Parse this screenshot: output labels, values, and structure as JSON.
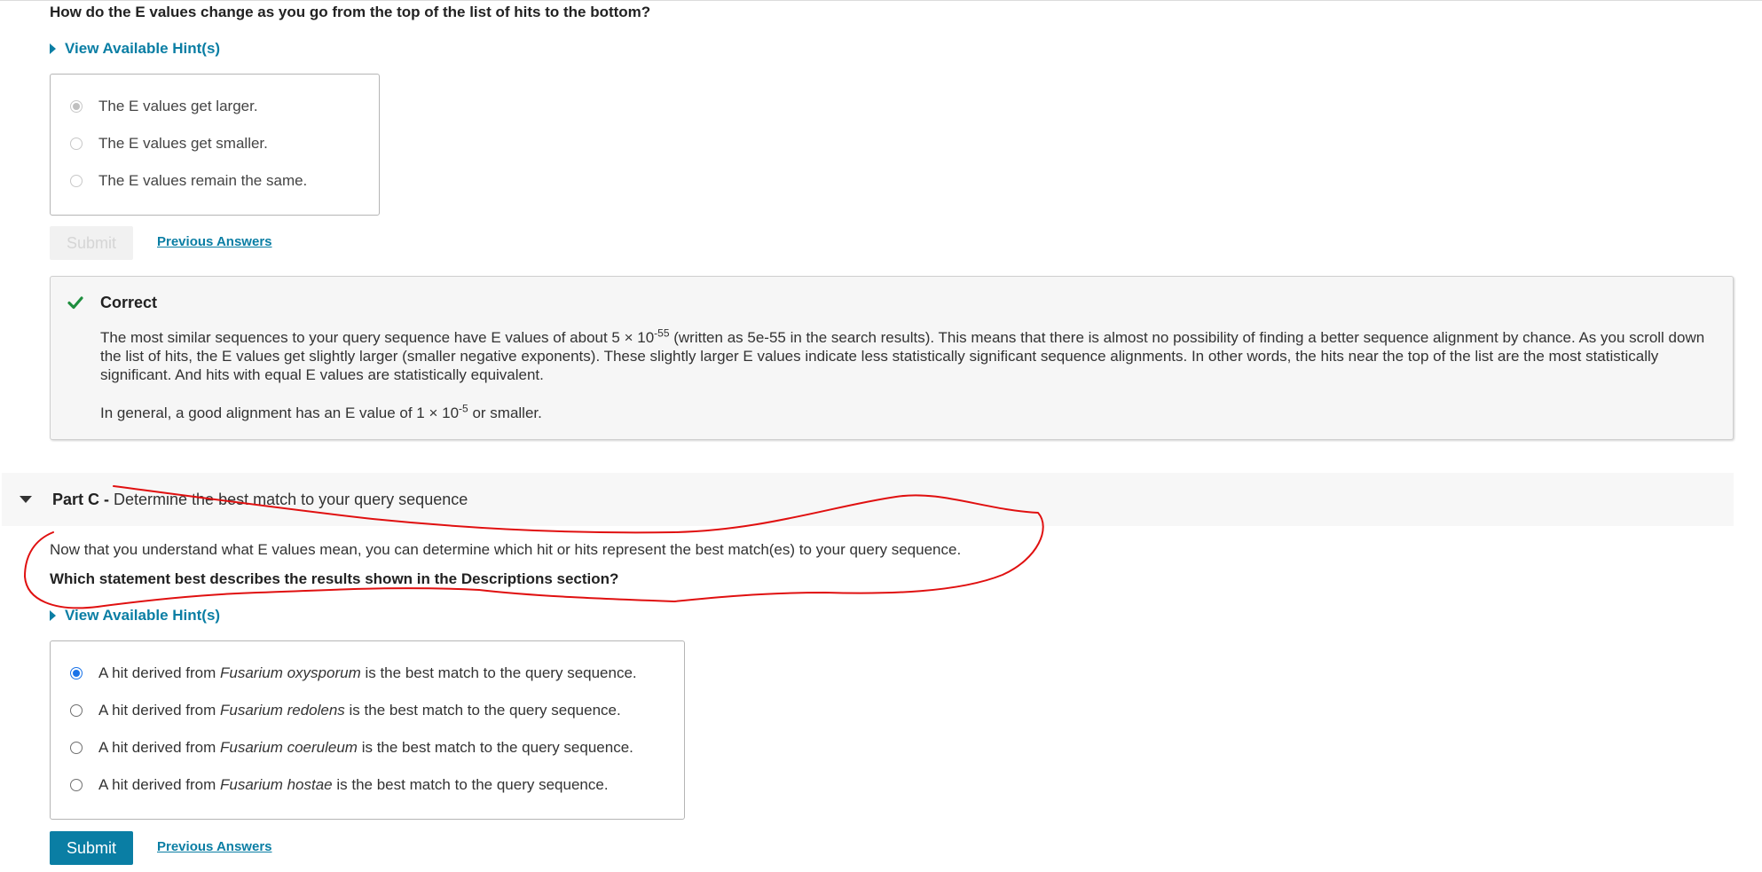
{
  "partB": {
    "question": "How do the E values change as you go from the top of the list of hits to the bottom?",
    "hint_label": "View Available Hint(s)",
    "options": [
      "The E values get larger.",
      "The E values get smaller.",
      "The E values remain the same."
    ],
    "submit_label": "Submit",
    "previous_answers_label": "Previous Answers",
    "feedback": {
      "status": "Correct",
      "p1_before": "The most similar sequences to your query sequence have E values of about 5 × 10",
      "p1_exp": "-55",
      "p1_after": " (written as 5e-55 in the search results). This means that there is almost no possibility of finding a better sequence alignment by chance. As you scroll down the list of hits, the E values get slightly larger (smaller negative exponents). These slightly larger E values indicate less statistically significant sequence alignments. In other words, the hits near the top of the list are the most statistically significant. And hits with equal E values are statistically equivalent.",
      "p2_before": "In general, a good alignment has an E value of 1 × 10",
      "p2_exp": "-5",
      "p2_after": " or smaller."
    }
  },
  "partC": {
    "label": "Part C - ",
    "title": "Determine the best match to your query sequence",
    "intro": "Now that you understand what E values mean, you can determine which hit or hits represent the best match(es) to your query sequence.",
    "question": "Which statement best describes the results shown in the Descriptions section?",
    "hint_label": "View Available Hint(s)",
    "options": [
      {
        "before": "A hit derived from ",
        "species": "Fusarium oxysporum",
        "after": " is the best match to the query sequence."
      },
      {
        "before": "A hit derived from ",
        "species": "Fusarium redolens",
        "after": " is the best match to the query sequence."
      },
      {
        "before": "A hit derived from ",
        "species": "Fusarium coeruleum",
        "after": " is the best match to the query sequence."
      },
      {
        "before": "A hit derived from ",
        "species": "Fusarium hostae",
        "after": " is the best match to the query sequence."
      }
    ],
    "selected_index": 0,
    "submit_label": "Submit",
    "previous_answers_label": "Previous Answers"
  },
  "colors": {
    "link": "#0a7ea4",
    "submit_active": "#0a7ea4",
    "correct_check": "#1e8e3e",
    "annotation": "#e01010",
    "radio_selected": "#1a73e8"
  },
  "icons": [
    "hint-triangle-icon",
    "check-icon",
    "caret-down-icon"
  ]
}
